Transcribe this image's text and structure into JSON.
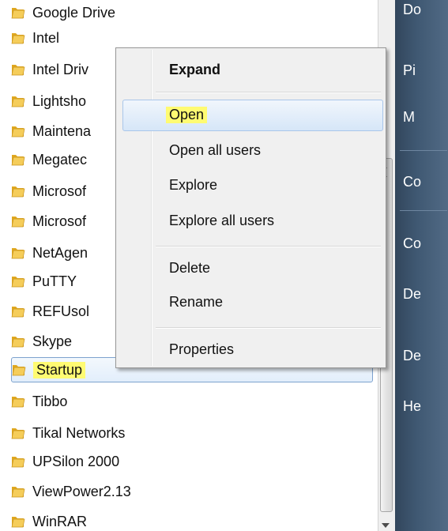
{
  "program_list": {
    "items": [
      {
        "label": "Google Drive"
      },
      {
        "label": "Intel"
      },
      {
        "label": "Intel Driv"
      },
      {
        "label": "Lightsho"
      },
      {
        "label": "Maintena"
      },
      {
        "label": "Megatec"
      },
      {
        "label": "Microsof"
      },
      {
        "label": "Microsof"
      },
      {
        "label": "NetAgen"
      },
      {
        "label": "PuTTY"
      },
      {
        "label": "REFUsol"
      },
      {
        "label": "Skype"
      },
      {
        "label": "Startup"
      },
      {
        "label": "Tibbo"
      },
      {
        "label": "Tikal Networks"
      },
      {
        "label": "UPSilon 2000"
      },
      {
        "label": "ViewPower2.13"
      },
      {
        "label": "WinRAR"
      }
    ],
    "selected_label": "Startup"
  },
  "context_menu": {
    "items": [
      {
        "label": "Expand",
        "bold": true
      },
      {
        "label": "Open",
        "hovered": true
      },
      {
        "label": "Open all users"
      },
      {
        "label": "Explore"
      },
      {
        "label": "Explore all users"
      },
      {
        "label": "Delete"
      },
      {
        "label": "Rename"
      },
      {
        "label": "Properties"
      }
    ]
  },
  "right_pane": {
    "items": [
      {
        "label": "Do"
      },
      {
        "label": "Pi"
      },
      {
        "label": "M"
      },
      {
        "label": "Co"
      },
      {
        "label": "Co"
      },
      {
        "label": "De"
      },
      {
        "label": "De"
      },
      {
        "label": "He"
      }
    ]
  },
  "colors": {
    "highlight": "#fffb72",
    "selection_border": "#7da2ce",
    "right_pane_bg": "#3f5872",
    "folder": "#e8b83c"
  },
  "icons": {
    "folder": "folder-icon",
    "scroll_down": "chevron-down-icon"
  }
}
